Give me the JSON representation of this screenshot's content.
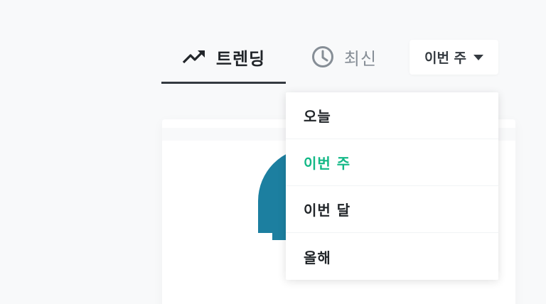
{
  "tabs": {
    "trending": {
      "label": "트렌딩",
      "icon": "trending-up-icon",
      "active": true
    },
    "recent": {
      "label": "최신",
      "icon": "clock-icon",
      "active": false
    }
  },
  "period": {
    "selected_label": "이번 주",
    "caret_icon": "caret-down-icon",
    "options": [
      {
        "label": "오늘",
        "active": false
      },
      {
        "label": "이번 주",
        "active": true
      },
      {
        "label": "이번 달",
        "active": false
      },
      {
        "label": "올해",
        "active": false
      }
    ]
  },
  "colors": {
    "accent": "#12b886",
    "tab_active": "#212529",
    "tab_inactive": "#868e96",
    "underline": "#343a40",
    "background": "#f8f9fa",
    "thumbnail_blue": "#1c7fa0"
  }
}
